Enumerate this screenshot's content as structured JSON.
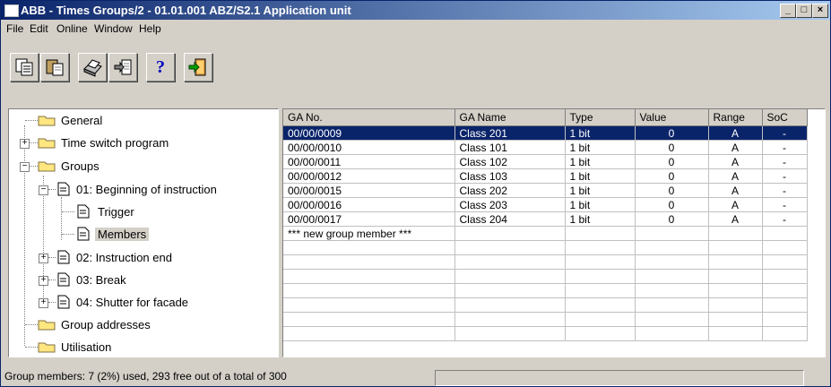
{
  "window": {
    "title": "ABB - Times Groups/2 - 01.01.001 ABZ/S2.1 Application unit",
    "minimize": "_",
    "maximize": "□",
    "close": "×"
  },
  "menu": {
    "file": "File",
    "edit": "Edit",
    "online": "Online",
    "window": "Window",
    "help": "Help"
  },
  "toolbar": {
    "icons": [
      "copy-icon",
      "paste-icon",
      "print-icon",
      "import-icon",
      "help-icon",
      "exit-icon"
    ],
    "help_glyph": "?"
  },
  "tree": {
    "general": "General",
    "time_switch": "Time switch program",
    "groups": "Groups",
    "g01": "01: Beginning of instruction",
    "trigger": "Trigger",
    "members": "Members",
    "g02": "02: Instruction end",
    "g03": "03: Break",
    "g04": "04: Shutter for facade",
    "group_addresses": "Group addresses",
    "utilisation": "Utilisation"
  },
  "table": {
    "columns": [
      "GA No.",
      "GA Name",
      "Type",
      "Value",
      "Range",
      "SoC"
    ],
    "rows": [
      [
        "00/00/0009",
        "Class 201",
        "1 bit",
        "0",
        "A",
        "-"
      ],
      [
        "00/00/0010",
        "Class 101",
        "1 bit",
        "0",
        "A",
        "-"
      ],
      [
        "00/00/0011",
        "Class 102",
        "1 bit",
        "0",
        "A",
        "-"
      ],
      [
        "00/00/0012",
        "Class 103",
        "1 bit",
        "0",
        "A",
        "-"
      ],
      [
        "00/00/0015",
        "Class 202",
        "1 bit",
        "0",
        "A",
        "-"
      ],
      [
        "00/00/0016",
        "Class 203",
        "1 bit",
        "0",
        "A",
        "-"
      ],
      [
        "00/00/0017",
        "Class 204",
        "1 bit",
        "0",
        "A",
        "-"
      ]
    ],
    "new_member": "*** new group member ***",
    "selected_row": 0
  },
  "status": {
    "text": "Group members: 7 (2%) used, 293 free out of a total of 300"
  },
  "colors": {
    "title_start": "#0a246a",
    "title_end": "#a6caf0",
    "selection": "#0a246a",
    "folder": "#ffe680"
  }
}
